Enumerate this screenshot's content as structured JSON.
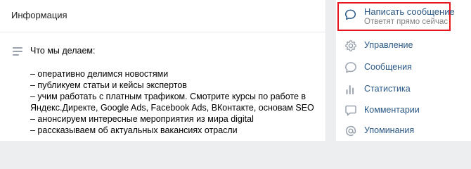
{
  "info": {
    "header": "Информация",
    "title": "Что мы делаем:",
    "lines": [
      "– оперативно делимся новостями",
      "– публикуем статьи и кейсы экспертов",
      "– учим работать с платным трафиком. Смотрите курсы по работе в",
      "Яндекс.Директе, Google Ads, Facebook Ads, ВКонтакте, основам SEO",
      "– анонсируем интересные мероприятия из мира digital",
      "– рассказываем об актуальных вакансиях отрасли"
    ]
  },
  "sidebar": {
    "write_message": {
      "title": "Написать сообщение",
      "subtitle": "Ответят прямо сейчас",
      "icon": "message-bubble-icon",
      "highlight_color": "#e8141c"
    },
    "items": [
      {
        "label": "Управление",
        "icon": "gear-icon"
      },
      {
        "label": "Сообщения",
        "icon": "message-bubble-icon"
      },
      {
        "label": "Статистика",
        "icon": "stats-bars-icon"
      },
      {
        "label": "Комментарии",
        "icon": "comment-icon"
      },
      {
        "label": "Упоминания",
        "icon": "at-sign-icon"
      }
    ]
  },
  "colors": {
    "link": "#2a5885",
    "icon": "#99a2ad",
    "page_bg": "#edeef0"
  }
}
